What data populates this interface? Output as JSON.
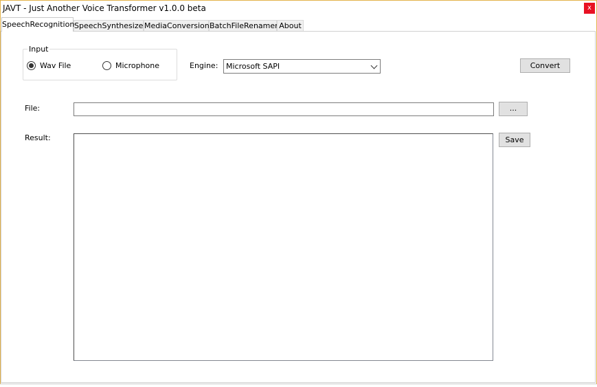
{
  "window": {
    "title": "JAVT - Just Another Voice Transformer v1.0.0 beta",
    "close_label": "x"
  },
  "tabs": [
    {
      "label": "SpeechRecognition",
      "active": true
    },
    {
      "label": "SpeechSynthesizer",
      "active": false
    },
    {
      "label": "MediaConversion",
      "active": false
    },
    {
      "label": "BatchFileRenamer",
      "active": false
    },
    {
      "label": "About",
      "active": false
    }
  ],
  "input_group": {
    "legend": "Input",
    "options": [
      {
        "label": "Wav File",
        "checked": true
      },
      {
        "label": "Microphone",
        "checked": false
      }
    ]
  },
  "engine": {
    "label": "Engine:",
    "selected": "Microsoft SAPI"
  },
  "convert_button": "Convert",
  "file": {
    "label": "File:",
    "value": "",
    "browse_label": "..."
  },
  "result": {
    "label": "Result:",
    "value": "",
    "save_label": "Save"
  }
}
